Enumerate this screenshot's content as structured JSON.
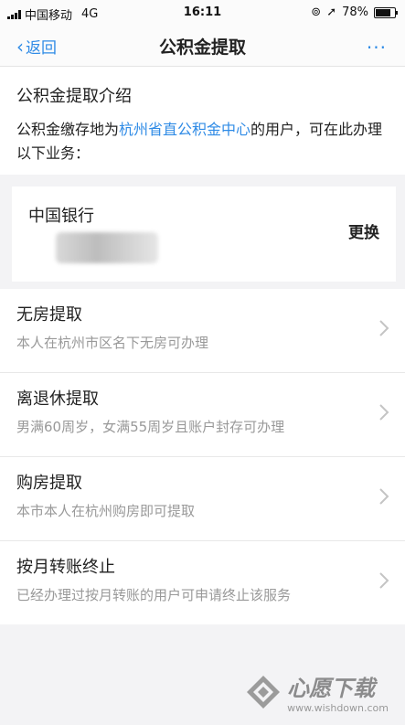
{
  "status_bar": {
    "carrier": "中国移动",
    "network": "4G",
    "time": "16:11",
    "battery": "78%",
    "battery_level": 0.78
  },
  "nav": {
    "back_label": "返回",
    "title": "公积金提取",
    "more": "···"
  },
  "intro": {
    "heading": "公积金提取介绍",
    "text_before": "公积金缴存地为",
    "link_text": "杭州省直公积金中心",
    "text_after": "的用户，可在此办理以下业务："
  },
  "bank": {
    "name": "中国银行",
    "change_label": "更换"
  },
  "items": [
    {
      "title": "无房提取",
      "desc": "本人在杭州市区名下无房可办理"
    },
    {
      "title": "离退休提取",
      "desc": "男满60周岁，女满55周岁且账户封存可办理"
    },
    {
      "title": "购房提取",
      "desc": "本市本人在杭州购房即可提取"
    },
    {
      "title": "按月转账终止",
      "desc": "已经办理过按月转账的用户可申请终止该服务"
    }
  ],
  "watermark": {
    "name": "心愿下载",
    "url": "www.wishdown.com"
  },
  "colors": {
    "accent": "#2f8be6",
    "secondary_text": "#999999",
    "background": "#f3f3f5"
  }
}
